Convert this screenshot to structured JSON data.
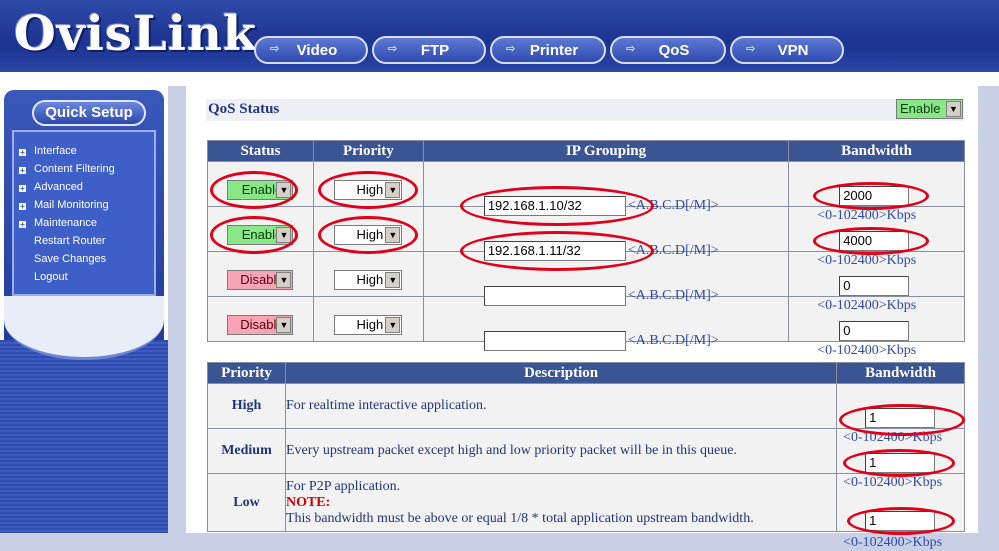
{
  "brand": {
    "logo": "OvisLink"
  },
  "nav": {
    "tabs": [
      "Video",
      "FTP",
      "Printer",
      "QoS",
      "VPN"
    ]
  },
  "sidebar": {
    "quick_setup": "Quick Setup",
    "items": [
      {
        "label": "Interface",
        "expandable": true
      },
      {
        "label": "Content Filtering",
        "expandable": true
      },
      {
        "label": "Advanced",
        "expandable": true
      },
      {
        "label": "Mail Monitoring",
        "expandable": true
      },
      {
        "label": "Maintenance",
        "expandable": true
      },
      {
        "label": "Restart Router",
        "expandable": false
      },
      {
        "label": "Save Changes",
        "expandable": false
      },
      {
        "label": "Logout",
        "expandable": false
      }
    ]
  },
  "qos": {
    "title": "QoS Status",
    "status_value": "Enable",
    "groups_table": {
      "headers": [
        "Status",
        "Priority",
        "IP Grouping",
        "Bandwidth"
      ],
      "rows": [
        {
          "status": "Enable",
          "priority": "High",
          "ip": "192.168.1.10/32",
          "ip_hint": "<A.B.C.D[/M]>",
          "bandwidth": "2000",
          "bw_hint": "<0-102400>Kbps"
        },
        {
          "status": "Enable",
          "priority": "High",
          "ip": "192.168.1.11/32",
          "ip_hint": "<A.B.C.D[/M]>",
          "bandwidth": "4000",
          "bw_hint": "<0-102400>Kbps"
        },
        {
          "status": "Disable",
          "priority": "High",
          "ip": "",
          "ip_hint": "<A.B.C.D[/M]>",
          "bandwidth": "0",
          "bw_hint": "<0-102400>Kbps"
        },
        {
          "status": "Disable",
          "priority": "High",
          "ip": "",
          "ip_hint": "<A.B.C.D[/M]>",
          "bandwidth": "0",
          "bw_hint": "<0-102400>Kbps"
        }
      ]
    },
    "priority_table": {
      "headers": [
        "Priority",
        "Description",
        "Bandwidth"
      ],
      "rows": [
        {
          "priority": "High",
          "description": "For realtime interactive application.",
          "bandwidth": "1",
          "bw_hint": "<0-102400>Kbps"
        },
        {
          "priority": "Medium",
          "description": "Every upstream packet except high and low priority packet will be in this queue.",
          "bandwidth": "1",
          "bw_hint": "<0-102400>Kbps"
        },
        {
          "priority": "Low",
          "description": "For P2P application.",
          "note_label": "NOTE:",
          "note_text": "This bandwidth must be above or equal 1/8 * total application upstream bandwidth.",
          "bandwidth": "1",
          "bw_hint": "<0-102400>Kbps"
        }
      ]
    }
  },
  "colors": {
    "header_blue": "#1c3390",
    "table_header": "#3a5594",
    "enable_green": "#88e888",
    "disable_pink": "#f7a4b4",
    "annotation_red": "#e0001a"
  }
}
